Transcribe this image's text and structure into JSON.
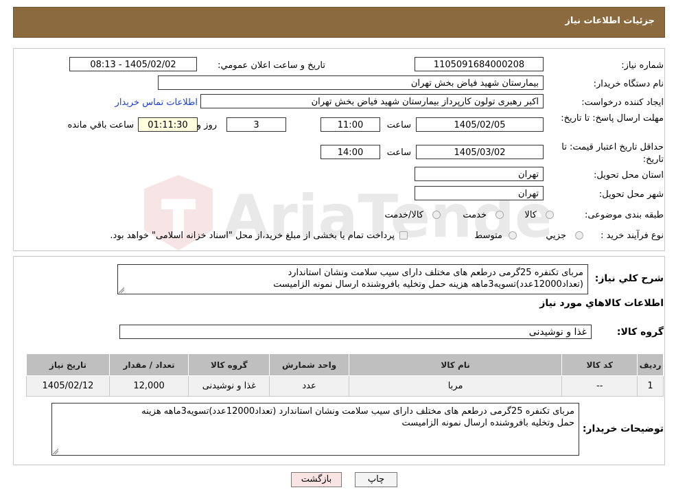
{
  "header": {
    "title": "جزئیات اطلاعات نیاز"
  },
  "form": {
    "need_number_label": "شماره نیاز:",
    "need_number": "1105091684000208",
    "announce_label": "تاریخ و ساعت اعلان عمومي:",
    "announce_value": "1405/02/02 - 08:13",
    "buyer_org_label": "نام دستگاه خريدار:",
    "buyer_org": "بیمارستان شهید فیاض بخش تهران",
    "creator_label": "ايجاد کننده درخواست:",
    "creator": "اکبر رهبری تولون کارپرداز بیمارستان شهید فیاض بخش تهران",
    "contact_link": "اطلاعات تماس خريدار",
    "deadline_label": "مهلت ارسال پاسخ: تا تاريخ:",
    "deadline_date": "1405/02/05",
    "time_label": "ساعت",
    "deadline_time": "11:00",
    "days": "3",
    "days_label": "روز و",
    "remaining": "01:11:30",
    "remaining_label": "ساعت باقي مانده",
    "validity_label": "حداقل تاريخ اعتبار قيمت: تا تاريخ:",
    "validity_date": "1405/03/02",
    "validity_time": "14:00",
    "province_label": "استان محل تحويل:",
    "province": "تهران",
    "city_label": "شهر محل تحويل:",
    "city": "تهران",
    "category_label": "طبقه بندی موضوعی:",
    "category_options": [
      "کالا",
      "خدمت",
      "کالا/خدمت"
    ],
    "process_label": "نوع فرآيند خريد :",
    "process_options": [
      "جزيي",
      "متوسط"
    ],
    "process_note": "پرداخت تمام يا بخشی از مبلغ خريد،از محل \"اسناد خزانه اسلامی\" خواهد بود."
  },
  "description": {
    "label": "شرح کلي نياز:",
    "line1": "مربای تکنفره  25گرمی درطعم های مختلف دارای سیب سلامت ونشان استاندارد",
    "line2": "(تعداد12000عدد)تسویه3ماهه هزینه حمل وتخلیه بافروشنده ارسال نمونه الزامیست"
  },
  "goods": {
    "section_title": "اطلاعات کالاهاي مورد نياز",
    "group_label": "گروه کالا:",
    "group_value": "غذا و نوشیدنی",
    "columns": [
      "رديف",
      "کد کالا",
      "نام کالا",
      "واحد شمارش",
      "گروه کالا",
      "تعداد / مقدار",
      "تاريخ نياز"
    ],
    "rows": [
      {
        "row": "1",
        "code": "--",
        "name": "مربا",
        "unit": "عدد",
        "group": "غذا و نوشیدنی",
        "qty": "12,000",
        "date": "1405/02/12"
      }
    ]
  },
  "buyer_notes": {
    "label": "توضيحات خريدار:",
    "line1": "مربای تکنفره  25گرمی درطعم های مختلف دارای سیب سلامت ونشان استاندارد (تعداد12000عدد)تسویه3ماهه هزینه",
    "line2": "حمل وتخلیه بافروشنده ارسال نمونه الزامیست"
  },
  "buttons": {
    "print": "چاپ",
    "back": "بازگشت"
  },
  "watermark": {
    "text": "AriaTender.neT"
  },
  "colors": {
    "header_bg": "#8b6a3e",
    "link": "#1a3fd0",
    "back_btn_bg": "#f9e3e3"
  }
}
